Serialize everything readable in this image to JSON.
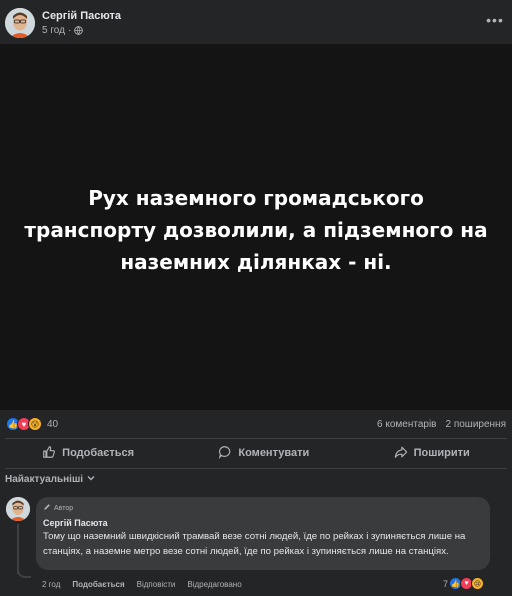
{
  "post": {
    "author": "Сергій Пасюта",
    "time": "5 год",
    "text": "Рух наземного громадського транспорту дозволили, а підземного на наземних ділянках - ні.",
    "reaction_count": "40",
    "comments_count": "6 коментарів",
    "shares_count": "2 поширення"
  },
  "actions": {
    "like": "Подобається",
    "comment": "Коментувати",
    "share": "Поширити"
  },
  "comments_sort": "Найактуальніші",
  "comment": {
    "badge": "Автор",
    "author": "Сергій Пасюта",
    "text": "Тому що наземний швидкісний трамвай везе сотні людей, їде по рейках і зупиняється лише на станціях, а наземне метро везе сотні людей, їде по рейках і зупиняється лише на станціях.",
    "time": "2 год",
    "like": "Подобається",
    "reply": "Відповісти",
    "edited": "Відредаговано",
    "reaction_count": "7"
  }
}
